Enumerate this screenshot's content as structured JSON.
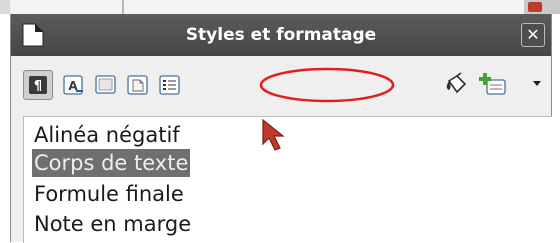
{
  "window": {
    "title": "Styles et formatage",
    "close_symbol": "✕"
  },
  "toolbar": {
    "buttons": [
      {
        "icon": "paragraph-styles-icon",
        "active": true
      },
      {
        "icon": "character-styles-icon",
        "active": false
      },
      {
        "icon": "frame-styles-icon",
        "active": false
      },
      {
        "icon": "page-styles-icon",
        "active": false
      },
      {
        "icon": "list-styles-icon",
        "active": false
      }
    ],
    "right_buttons": [
      {
        "icon": "fill-format-mode-icon"
      },
      {
        "icon": "new-style-from-selection-icon"
      }
    ],
    "menu_arrow_icon": "dropdown-arrow-icon"
  },
  "annotation": {
    "shape": "ellipse",
    "color": "#e02020"
  },
  "styles_list": [
    {
      "label": "Alinéa négatif",
      "selected": false
    },
    {
      "label": "Corps de texte",
      "selected": true
    },
    {
      "label": "Formule finale",
      "selected": false
    },
    {
      "label": "Note en marge",
      "selected": false
    }
  ],
  "colors": {
    "titlebar": "#4f4f4f",
    "panel": "#efefef",
    "selection": "#6f6f6f",
    "annotation_red": "#e02020",
    "cursor_red": "#c0392b"
  }
}
